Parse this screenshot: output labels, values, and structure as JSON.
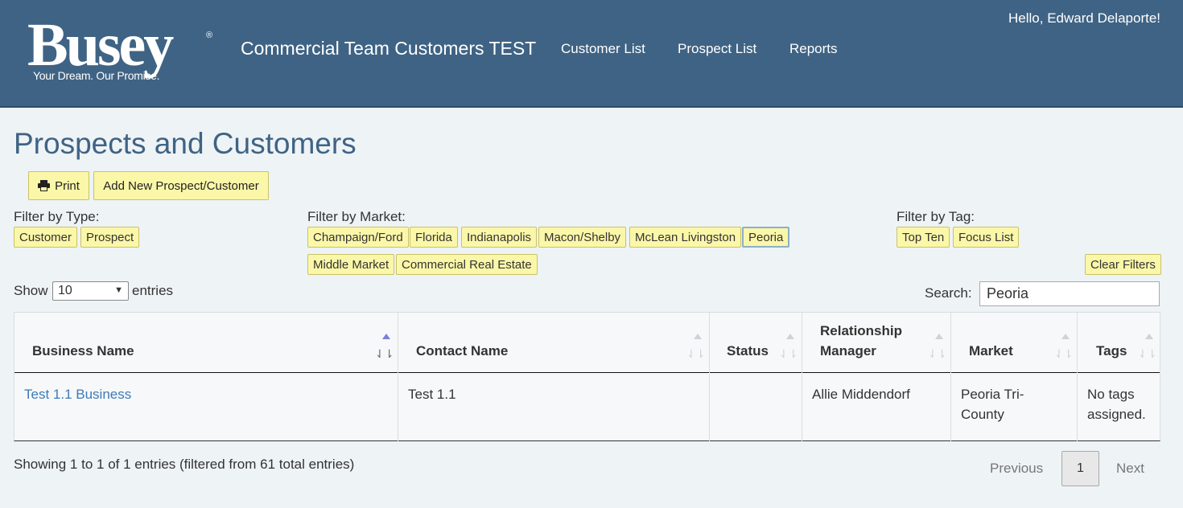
{
  "header": {
    "logo_word": "Busey",
    "logo_reg": "®",
    "logo_tagline": "Your Dream. Our Promise.",
    "app_title": "Commercial Team Customers TEST",
    "nav": [
      "Customer List",
      "Prospect List",
      "Reports"
    ],
    "greeting": "Hello, Edward Delaporte!"
  },
  "page_title": "Prospects and Customers",
  "toolbar": {
    "print_label": "Print",
    "add_label": "Add New Prospect/Customer",
    "print_icon": "printer-icon"
  },
  "filters": {
    "type_label": "Filter by Type:",
    "types": [
      "Customer",
      "Prospect"
    ],
    "market_label": "Filter by Market:",
    "markets": [
      "Champaign/Ford",
      "Florida",
      "Indianapolis",
      "Macon/Shelby",
      "McLean Livingston",
      "Peoria",
      "Middle Market",
      "Commercial Real Estate"
    ],
    "active_market": "Peoria",
    "tag_label": "Filter by Tag:",
    "tags": [
      "Top Ten",
      "Focus List"
    ],
    "clear_label": "Clear Filters"
  },
  "controls": {
    "show_label": "Show",
    "entries_value": "10",
    "entries_label": "entries",
    "search_label": "Search:",
    "search_value": "Peoria"
  },
  "table": {
    "columns": [
      "Business Name",
      "Contact Name",
      "Status",
      "Relationship Manager",
      "Market",
      "Tags"
    ],
    "sorted_column": "Business Name",
    "rows": [
      {
        "business": "Test 1.1 Business",
        "contact": "Test 1.1",
        "status": "",
        "manager": "Allie Middendorf",
        "market": "Peoria Tri-County",
        "tags": "No tags assigned."
      }
    ]
  },
  "footer": {
    "info": "Showing 1 to 1 of 1 entries (filtered from 61 total entries)",
    "previous": "Previous",
    "page": "1",
    "next": "Next"
  },
  "colors": {
    "header_bg": "#3f6384",
    "chip_bg": "#fbf7a8",
    "link": "#3d7bb8"
  }
}
